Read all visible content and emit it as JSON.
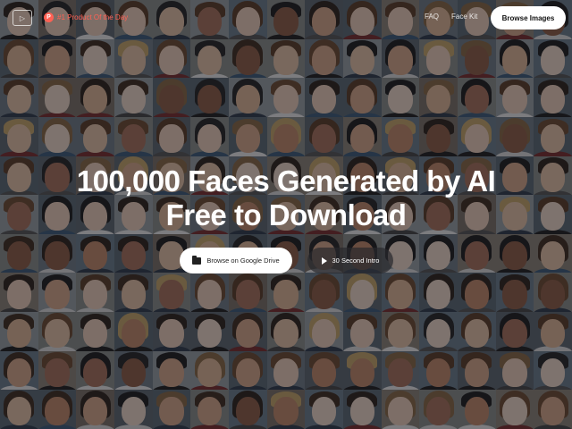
{
  "header": {
    "logo_glyph": "▷",
    "producthunt_glyph": "P",
    "producthunt_badge": "#1 Product Of the Day",
    "nav": [
      {
        "label": "FAQ"
      },
      {
        "label": "Face Kit"
      }
    ],
    "browse_images_label": "Browse Images"
  },
  "hero": {
    "title_line1": "100,000 Faces Generated by AI",
    "title_line2": "Free to Download"
  },
  "actions": {
    "drive_label": "Browse on Google Drive",
    "intro_label": "30 Second Intro"
  },
  "icons": {
    "logo": "play-logo-icon",
    "producthunt": "producthunt-icon",
    "drive": "folder-icon",
    "intro": "play-icon"
  },
  "colors": {
    "accent": "#ff6154",
    "button_bg": "#ffffff",
    "overlay": "rgba(20,20,24,0.52)"
  }
}
